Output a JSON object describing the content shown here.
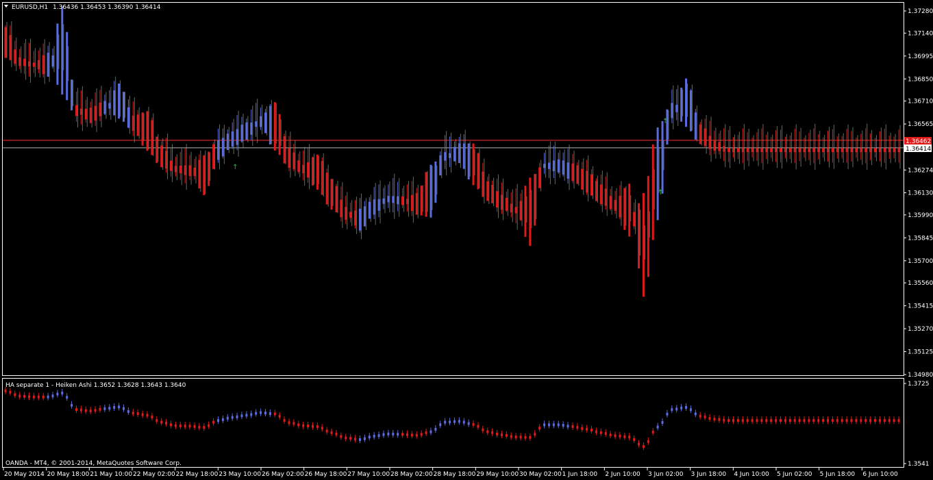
{
  "main_window": {
    "title": "EURUSD,H1",
    "ohlc": "1.36436 1.36453 1.36390 1.36414",
    "menu_icon": "triangle-down-icon"
  },
  "sub_window": {
    "title": "HA separate 1 -  Heiken Ashi  1.3652 1.3628 1.3643 1.3640",
    "copyright": "OANDA - MT4, © 2001-2014, MetaQuotes Software Corp."
  },
  "colors": {
    "background": "#000000",
    "frame": "#ffffff",
    "bull": "#5b6be0",
    "bear": "#e01a1a",
    "bars": "#8a9a8a",
    "arrow": "#2fbf3f",
    "ask_line": "#ff2a2a",
    "bid_line": "#b5b5b5",
    "ask_label_bg": "#e01a1a",
    "bid_label_bg": "#ffffff"
  },
  "chart_data": [
    {
      "type": "line",
      "name": "main",
      "symbol": "EURUSD",
      "timeframe": "H1",
      "y_ticks": [
        "1.37280",
        "1.37140",
        "1.36995",
        "1.36850",
        "1.36710",
        "1.36565",
        "1.36274",
        "1.36130",
        "1.35990",
        "1.35845",
        "1.35700",
        "1.35560",
        "1.35415",
        "1.35270",
        "1.35125",
        "1.34980"
      ],
      "ylim": [
        1.3498,
        1.3728
      ],
      "price_labels": {
        "ask": "1.36462",
        "bid": "1.36414"
      },
      "ask": 1.36462,
      "bid": 1.36414,
      "series": [
        {
          "name": "Heiken Ashi",
          "t": [
            0,
            3,
            6,
            9,
            12,
            15,
            18,
            21,
            24,
            27,
            30,
            33,
            36,
            39,
            42,
            45,
            48,
            51,
            54,
            57,
            60,
            63,
            66,
            69,
            72,
            75,
            78,
            81,
            84,
            87,
            90,
            93,
            96,
            99,
            102,
            105,
            108,
            111,
            114,
            117,
            120,
            123,
            126,
            129,
            132,
            135,
            138,
            141,
            144,
            147,
            150,
            153,
            156,
            159,
            162,
            165,
            168,
            171,
            174,
            177,
            180,
            183,
            186,
            189
          ],
          "values": [
            1.3708,
            1.3696,
            1.3694,
            1.3694,
            1.3703,
            1.3665,
            1.3662,
            1.3667,
            1.3671,
            1.3657,
            1.3652,
            1.3636,
            1.3628,
            1.3627,
            1.3624,
            1.364,
            1.3647,
            1.3652,
            1.3658,
            1.3655,
            1.3635,
            1.3628,
            1.3626,
            1.3612,
            1.36,
            1.3596,
            1.3604,
            1.3609,
            1.3608,
            1.3606,
            1.3614,
            1.3636,
            1.3638,
            1.3631,
            1.3614,
            1.3607,
            1.3602,
            1.3601,
            1.363,
            1.363,
            1.3626,
            1.362,
            1.3612,
            1.3605,
            1.3602,
            1.358,
            1.3625,
            1.3665,
            1.367,
            1.365,
            1.3643,
            1.364,
            1.364,
            1.364,
            1.364,
            1.364,
            1.364,
            1.364,
            1.364,
            1.364,
            1.364,
            1.364,
            1.364,
            1.364
          ],
          "trend": [
            "bear",
            "bear",
            "bear",
            "bull",
            "bull",
            "bear",
            "bear",
            "bull",
            "bull",
            "bear",
            "bear",
            "bear",
            "bear",
            "bear",
            "bear",
            "bull",
            "bull",
            "bull",
            "bull",
            "bear",
            "bear",
            "bear",
            "bear",
            "bear",
            "bear",
            "bull",
            "bull",
            "bull",
            "bear",
            "bear",
            "bull",
            "bull",
            "bull",
            "bear",
            "bear",
            "bear",
            "bear",
            "bear",
            "bull",
            "bull",
            "bear",
            "bear",
            "bear",
            "bear",
            "bear",
            "bear",
            "bull",
            "bull",
            "bull",
            "bear",
            "bear",
            "bear",
            "bear",
            "bear",
            "bear",
            "bear",
            "bear",
            "bear",
            "bear",
            "bear",
            "bear",
            "bear",
            "bear",
            "bear"
          ]
        }
      ]
    },
    {
      "type": "line",
      "name": "sub",
      "y_ticks": [
        "1.3725",
        "1.3541"
      ],
      "ylim": [
        1.3541,
        1.3725
      ]
    }
  ],
  "x_axis": {
    "labels": [
      "20 May 2014",
      "20 May 18:00",
      "21 May 10:00",
      "22 May 02:00",
      "22 May 18:00",
      "23 May 10:00",
      "26 May 02:00",
      "26 May 18:00",
      "27 May 10:00",
      "28 May 02:00",
      "28 May 18:00",
      "29 May 10:00",
      "30 May 02:00",
      "1 Jun 18:00",
      "2 Jun 10:00",
      "3 Jun 02:00",
      "3 Jun 18:00",
      "4 Jun 10:00",
      "5 Jun 02:00",
      "5 Jun 18:00",
      "6 Jun 10:00"
    ]
  }
}
